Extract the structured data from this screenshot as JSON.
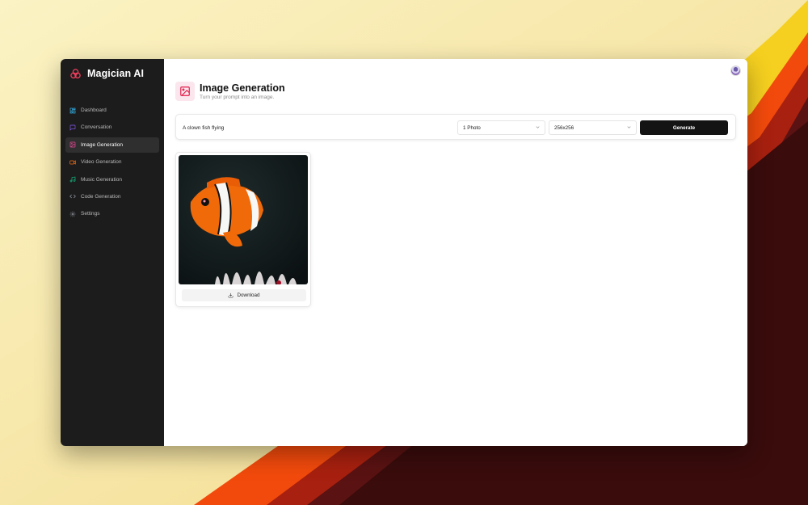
{
  "app": {
    "name": "Magician AI"
  },
  "sidebar": {
    "items": [
      {
        "label": "Dashboard",
        "icon": "dashboard-icon",
        "color": "#38bdf8"
      },
      {
        "label": "Conversation",
        "icon": "message-icon",
        "color": "#8b5cf6"
      },
      {
        "label": "Image Generation",
        "icon": "image-icon",
        "color": "#ec4899"
      },
      {
        "label": "Video Generation",
        "icon": "video-icon",
        "color": "#f97316"
      },
      {
        "label": "Music Generation",
        "icon": "music-icon",
        "color": "#10b981"
      },
      {
        "label": "Code Generation",
        "icon": "code-icon",
        "color": "#9ca3af"
      },
      {
        "label": "Settings",
        "icon": "settings-icon",
        "color": "#9ca3af"
      }
    ]
  },
  "page": {
    "title": "Image Generation",
    "subtitle": "Turn your prompt into an image."
  },
  "form": {
    "prompt_value": "A clown fish flying",
    "amount": "1 Photo",
    "resolution": "256x256",
    "generate_label": "Generate"
  },
  "results": [
    {
      "download_label": "Download"
    }
  ],
  "colors": {
    "accent": "#e11d48",
    "sidebar_bg": "#1c1c1c",
    "button_bg": "#141414"
  }
}
